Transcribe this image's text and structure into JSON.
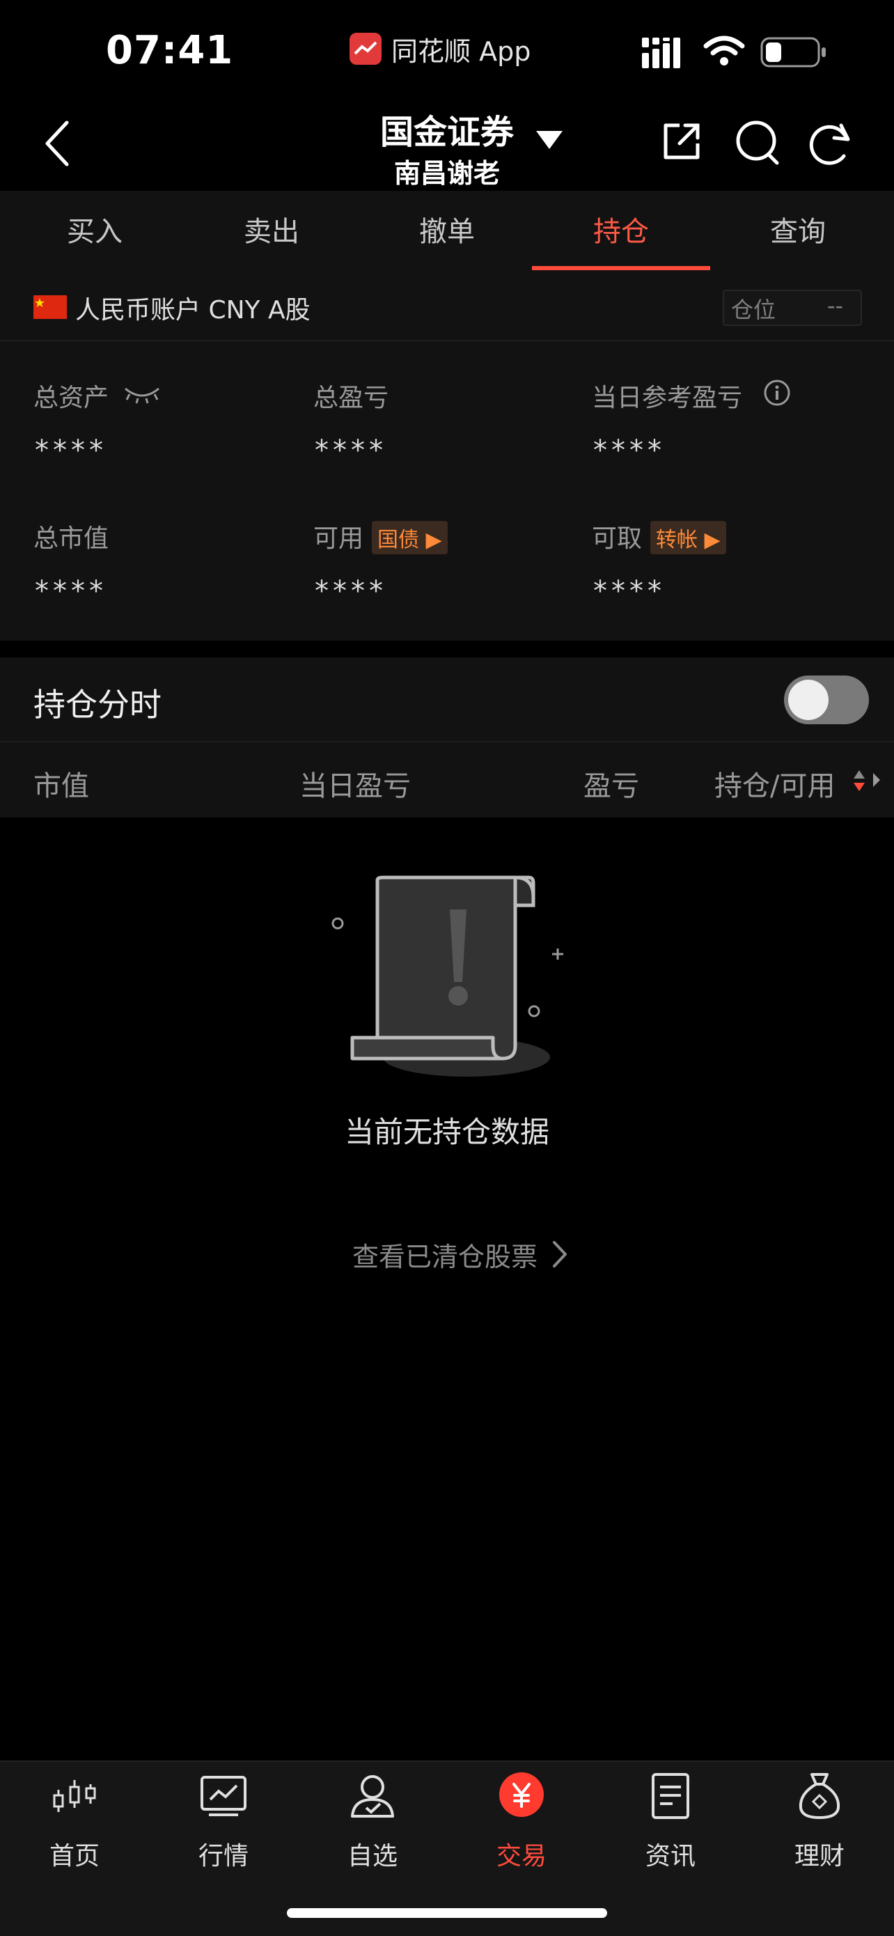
{
  "status_bar": {
    "time": "07:41",
    "app_indicator": "同花顺 App"
  },
  "nav": {
    "title": "国金证券",
    "subtitle": "南昌谢老"
  },
  "tabs": [
    {
      "label": "买入"
    },
    {
      "label": "卖出"
    },
    {
      "label": "撤单"
    },
    {
      "label": "持仓",
      "active": true
    },
    {
      "label": "查询"
    }
  ],
  "account": {
    "label": "人民币账户 CNY A股",
    "position_label": "仓位",
    "position_value": "--"
  },
  "metrics": {
    "total_assets": {
      "label": "总资产",
      "value": "****"
    },
    "total_pnl": {
      "label": "总盈亏",
      "value": "****"
    },
    "daily_ref_pnl": {
      "label": "当日参考盈亏",
      "value": "****"
    },
    "total_market_value": {
      "label": "总市值",
      "value": "****"
    },
    "available": {
      "label": "可用",
      "badge": "国债",
      "value": "****"
    },
    "withdrawable": {
      "label": "可取",
      "badge": "转帐",
      "value": "****"
    }
  },
  "holdings_timeshare": {
    "label": "持仓分时",
    "enabled": false
  },
  "columns": {
    "market_value": "市值",
    "daily_pnl": "当日盈亏",
    "pnl": "盈亏",
    "position_available": "持仓/可用"
  },
  "empty_state": {
    "message": "当前无持仓数据",
    "cleared_link": "查看已清仓股票"
  },
  "tabbar": [
    {
      "label": "首页",
      "icon": "candlestick-icon"
    },
    {
      "label": "行情",
      "icon": "chart-icon"
    },
    {
      "label": "自选",
      "icon": "user-icon"
    },
    {
      "label": "交易",
      "icon": "yuan-icon",
      "active": true
    },
    {
      "label": "资讯",
      "icon": "news-icon"
    },
    {
      "label": "理财",
      "icon": "money-bag-icon"
    }
  ],
  "colors": {
    "accent": "#ff4b3c",
    "badge_text": "#ff8a3a",
    "background": "#000000",
    "panel": "#121212"
  }
}
